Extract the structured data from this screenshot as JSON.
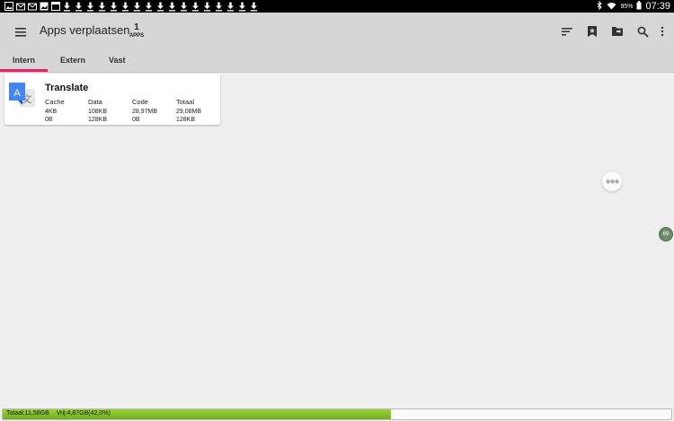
{
  "status_bar": {
    "notification_icons": [
      "image-icon",
      "mail-icon",
      "mail-icon",
      "gallery-icon",
      "window-icon",
      "download-icon",
      "download-icon",
      "download-icon",
      "download-icon",
      "download-icon",
      "download-icon",
      "download-icon",
      "download-icon",
      "download-icon",
      "download-icon",
      "download-icon",
      "download-icon",
      "download-icon",
      "download-icon",
      "download-icon",
      "download-icon",
      "download-icon"
    ],
    "battery": "95%",
    "time": "07:39"
  },
  "toolbar": {
    "title": "Apps verplaatsen",
    "count": "1",
    "count_label": "APPS",
    "icons": [
      "sort-icon",
      "bookmark-star-icon",
      "folder-move-icon",
      "search-icon",
      "more-vert-icon"
    ]
  },
  "tabs": [
    {
      "label": "Intern",
      "active": true
    },
    {
      "label": "Extern",
      "active": false
    },
    {
      "label": "Vast",
      "active": false
    }
  ],
  "apps": [
    {
      "name": "Translate",
      "icon": "translate-icon",
      "columns": [
        {
          "header": "Cache",
          "values": [
            "4KB",
            "0B"
          ]
        },
        {
          "header": "Data",
          "values": [
            "108KB",
            "128KB"
          ]
        },
        {
          "header": "Code",
          "values": [
            "28,97MB",
            "0B"
          ]
        },
        {
          "header": "Totaal",
          "values": [
            "29,08MB",
            "128KB"
          ]
        }
      ]
    }
  ],
  "fab": {
    "icon": "more-horiz-icon"
  },
  "floating_badge": "69",
  "storage": {
    "total": "Totaal:11,58GB",
    "free": "Vrij:4,87GB(42,0%)",
    "used_fraction": 0.58
  },
  "colors": {
    "tab_indicator": "#e91e63",
    "storage_fill": "#8cc832",
    "toolbar_bg": "#d6d6d6"
  }
}
